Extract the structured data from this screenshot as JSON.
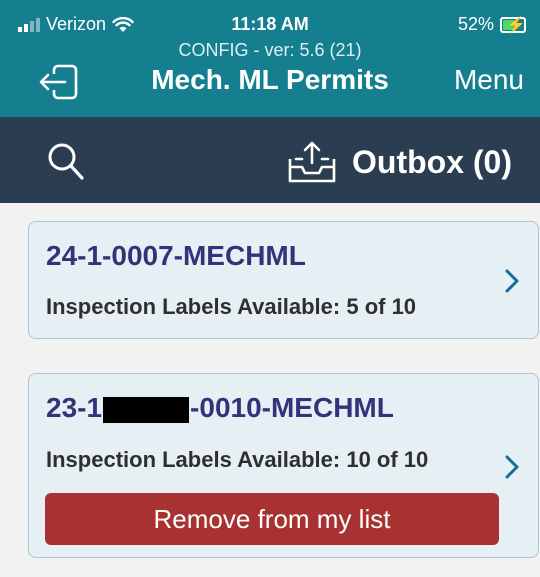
{
  "status_bar": {
    "carrier": "Verizon",
    "time": "11:18 AM",
    "battery": "52%",
    "battery_level": 0.52,
    "signal_bars": 2
  },
  "header": {
    "config": "CONFIG - ver: 5.6 (21)",
    "title": "Mech. ML Permits",
    "menu_label": "Menu",
    "exit_icon": "exit-icon"
  },
  "toolbar": {
    "search_icon": "search-icon",
    "outbox_icon": "outbox-tray-icon",
    "outbox_label": "Outbox (0)"
  },
  "permits": [
    {
      "id": "24-1-0007-MECHML",
      "labels_text": "Inspection Labels Available: 5 of 10"
    },
    {
      "id_prefix": "23-1",
      "id_suffix": "-0010-MECHML",
      "labels_text": "Inspection Labels Available: 10 of 10",
      "remove_label": "Remove from my list"
    }
  ],
  "colors": {
    "header_bg": "#157f8f",
    "toolbar_bg": "#2b3d50",
    "card_bg": "#e6f0f4",
    "permit_id": "#33337a",
    "remove_bg": "#a83232"
  }
}
